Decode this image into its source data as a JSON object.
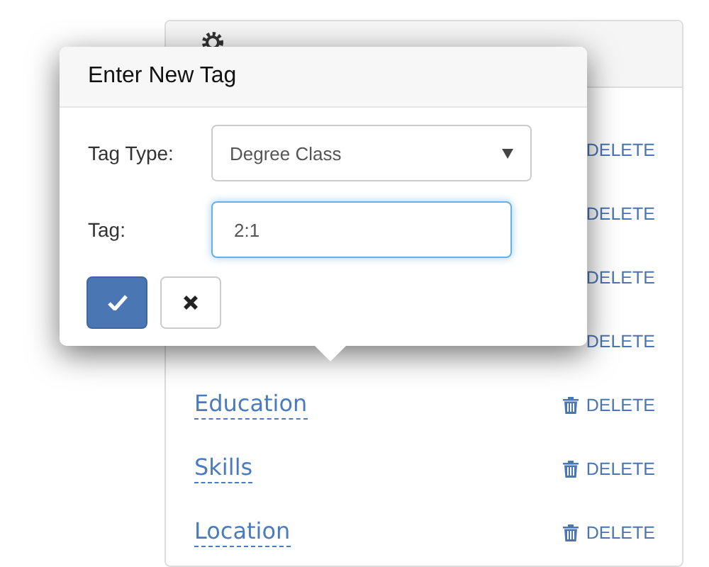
{
  "tag_list": {
    "rows": [
      {
        "delete_label": "DELETE"
      },
      {
        "delete_label": "DELETE"
      },
      {
        "delete_label": "DELETE"
      },
      {
        "delete_label": "DELETE"
      },
      {
        "name": "Education",
        "delete_label": "DELETE"
      },
      {
        "name": "Skills",
        "delete_label": "DELETE"
      },
      {
        "name": "Location",
        "delete_label": "DELETE"
      }
    ]
  },
  "popup": {
    "title": "Enter New Tag",
    "tag_type_label": "Tag Type:",
    "tag_type_value": "Degree Class",
    "tag_label": "Tag:",
    "tag_value": "2:1",
    "focused": true
  }
}
